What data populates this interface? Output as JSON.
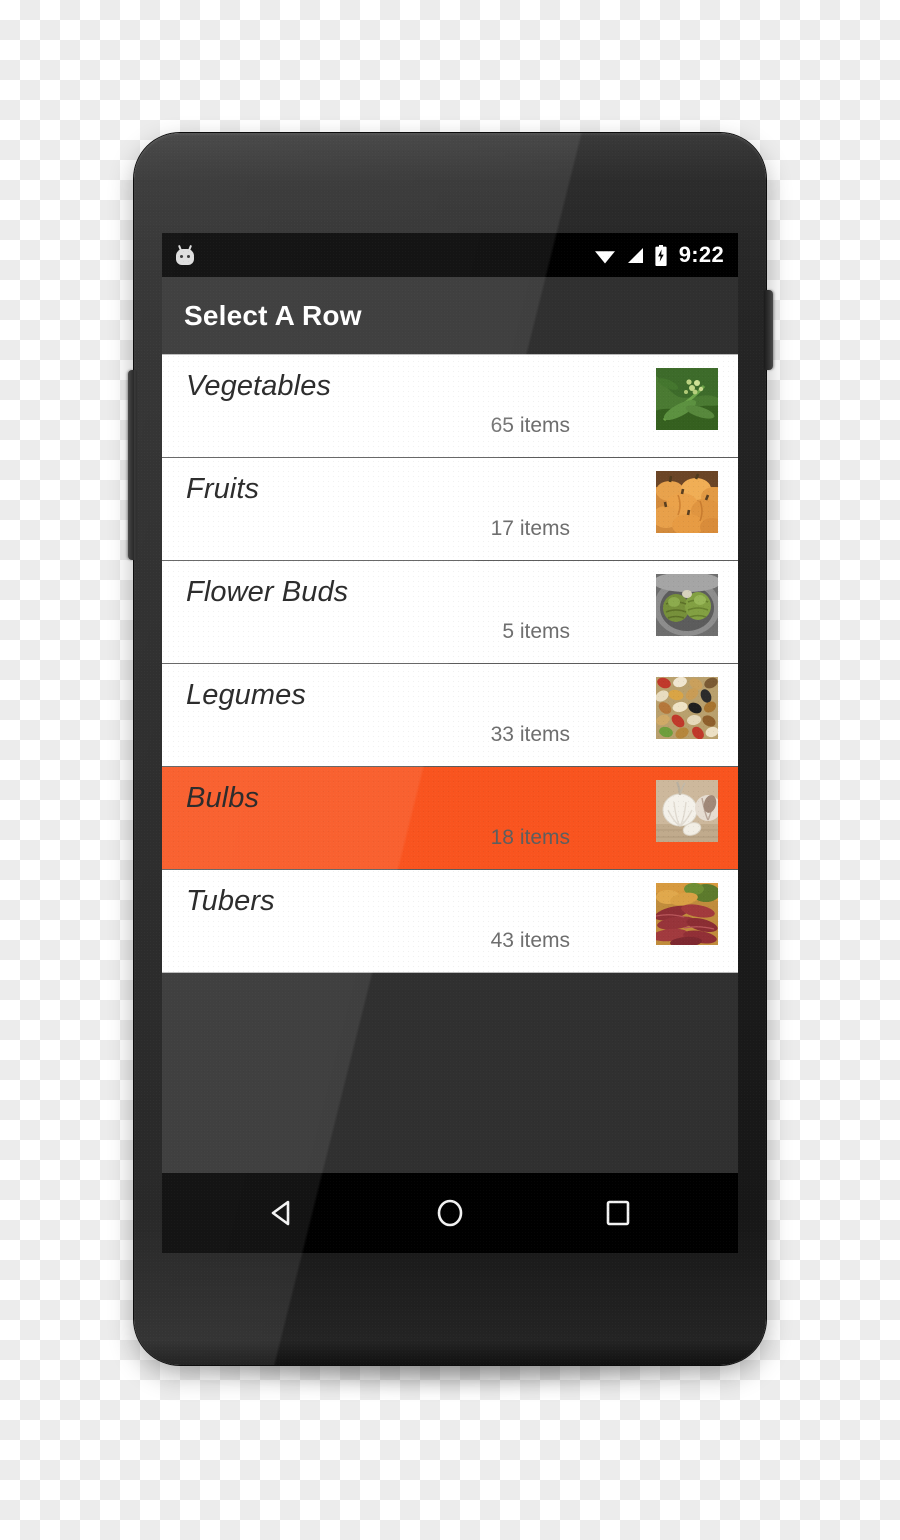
{
  "status_bar": {
    "notification_icon": "android-bugdroid-icon",
    "wifi_icon": "wifi-icon",
    "signal_icon": "cellular-signal-icon",
    "battery_icon": "battery-charging-icon",
    "clock": "9:22"
  },
  "action_bar": {
    "title": "Select A Row",
    "background": "#303030"
  },
  "theme": {
    "accent_selected": "#f9541f",
    "list_background": "#ffffff",
    "window_background": "#303030",
    "title_color": "#1a1a1a",
    "subtitle_color": "#6e6e6e"
  },
  "list": {
    "rows": [
      {
        "title": "Vegetables",
        "count": "65 items",
        "thumb": "leafy-greens-thumbnail",
        "selected": false
      },
      {
        "title": "Fruits",
        "count": "17 items",
        "thumb": "pumpkins-thumbnail",
        "selected": false
      },
      {
        "title": "Flower Buds",
        "count": "5 items",
        "thumb": "artichokes-thumbnail",
        "selected": false
      },
      {
        "title": "Legumes",
        "count": "33 items",
        "thumb": "mixed-beans-thumbnail",
        "selected": false
      },
      {
        "title": "Bulbs",
        "count": "18 items",
        "thumb": "garlic-thumbnail",
        "selected": true
      },
      {
        "title": "Tubers",
        "count": "43 items",
        "thumb": "red-tubers-thumbnail",
        "selected": false
      }
    ]
  },
  "nav_bar": {
    "back_label": "Back",
    "home_label": "Home",
    "recents_label": "Recent apps"
  }
}
